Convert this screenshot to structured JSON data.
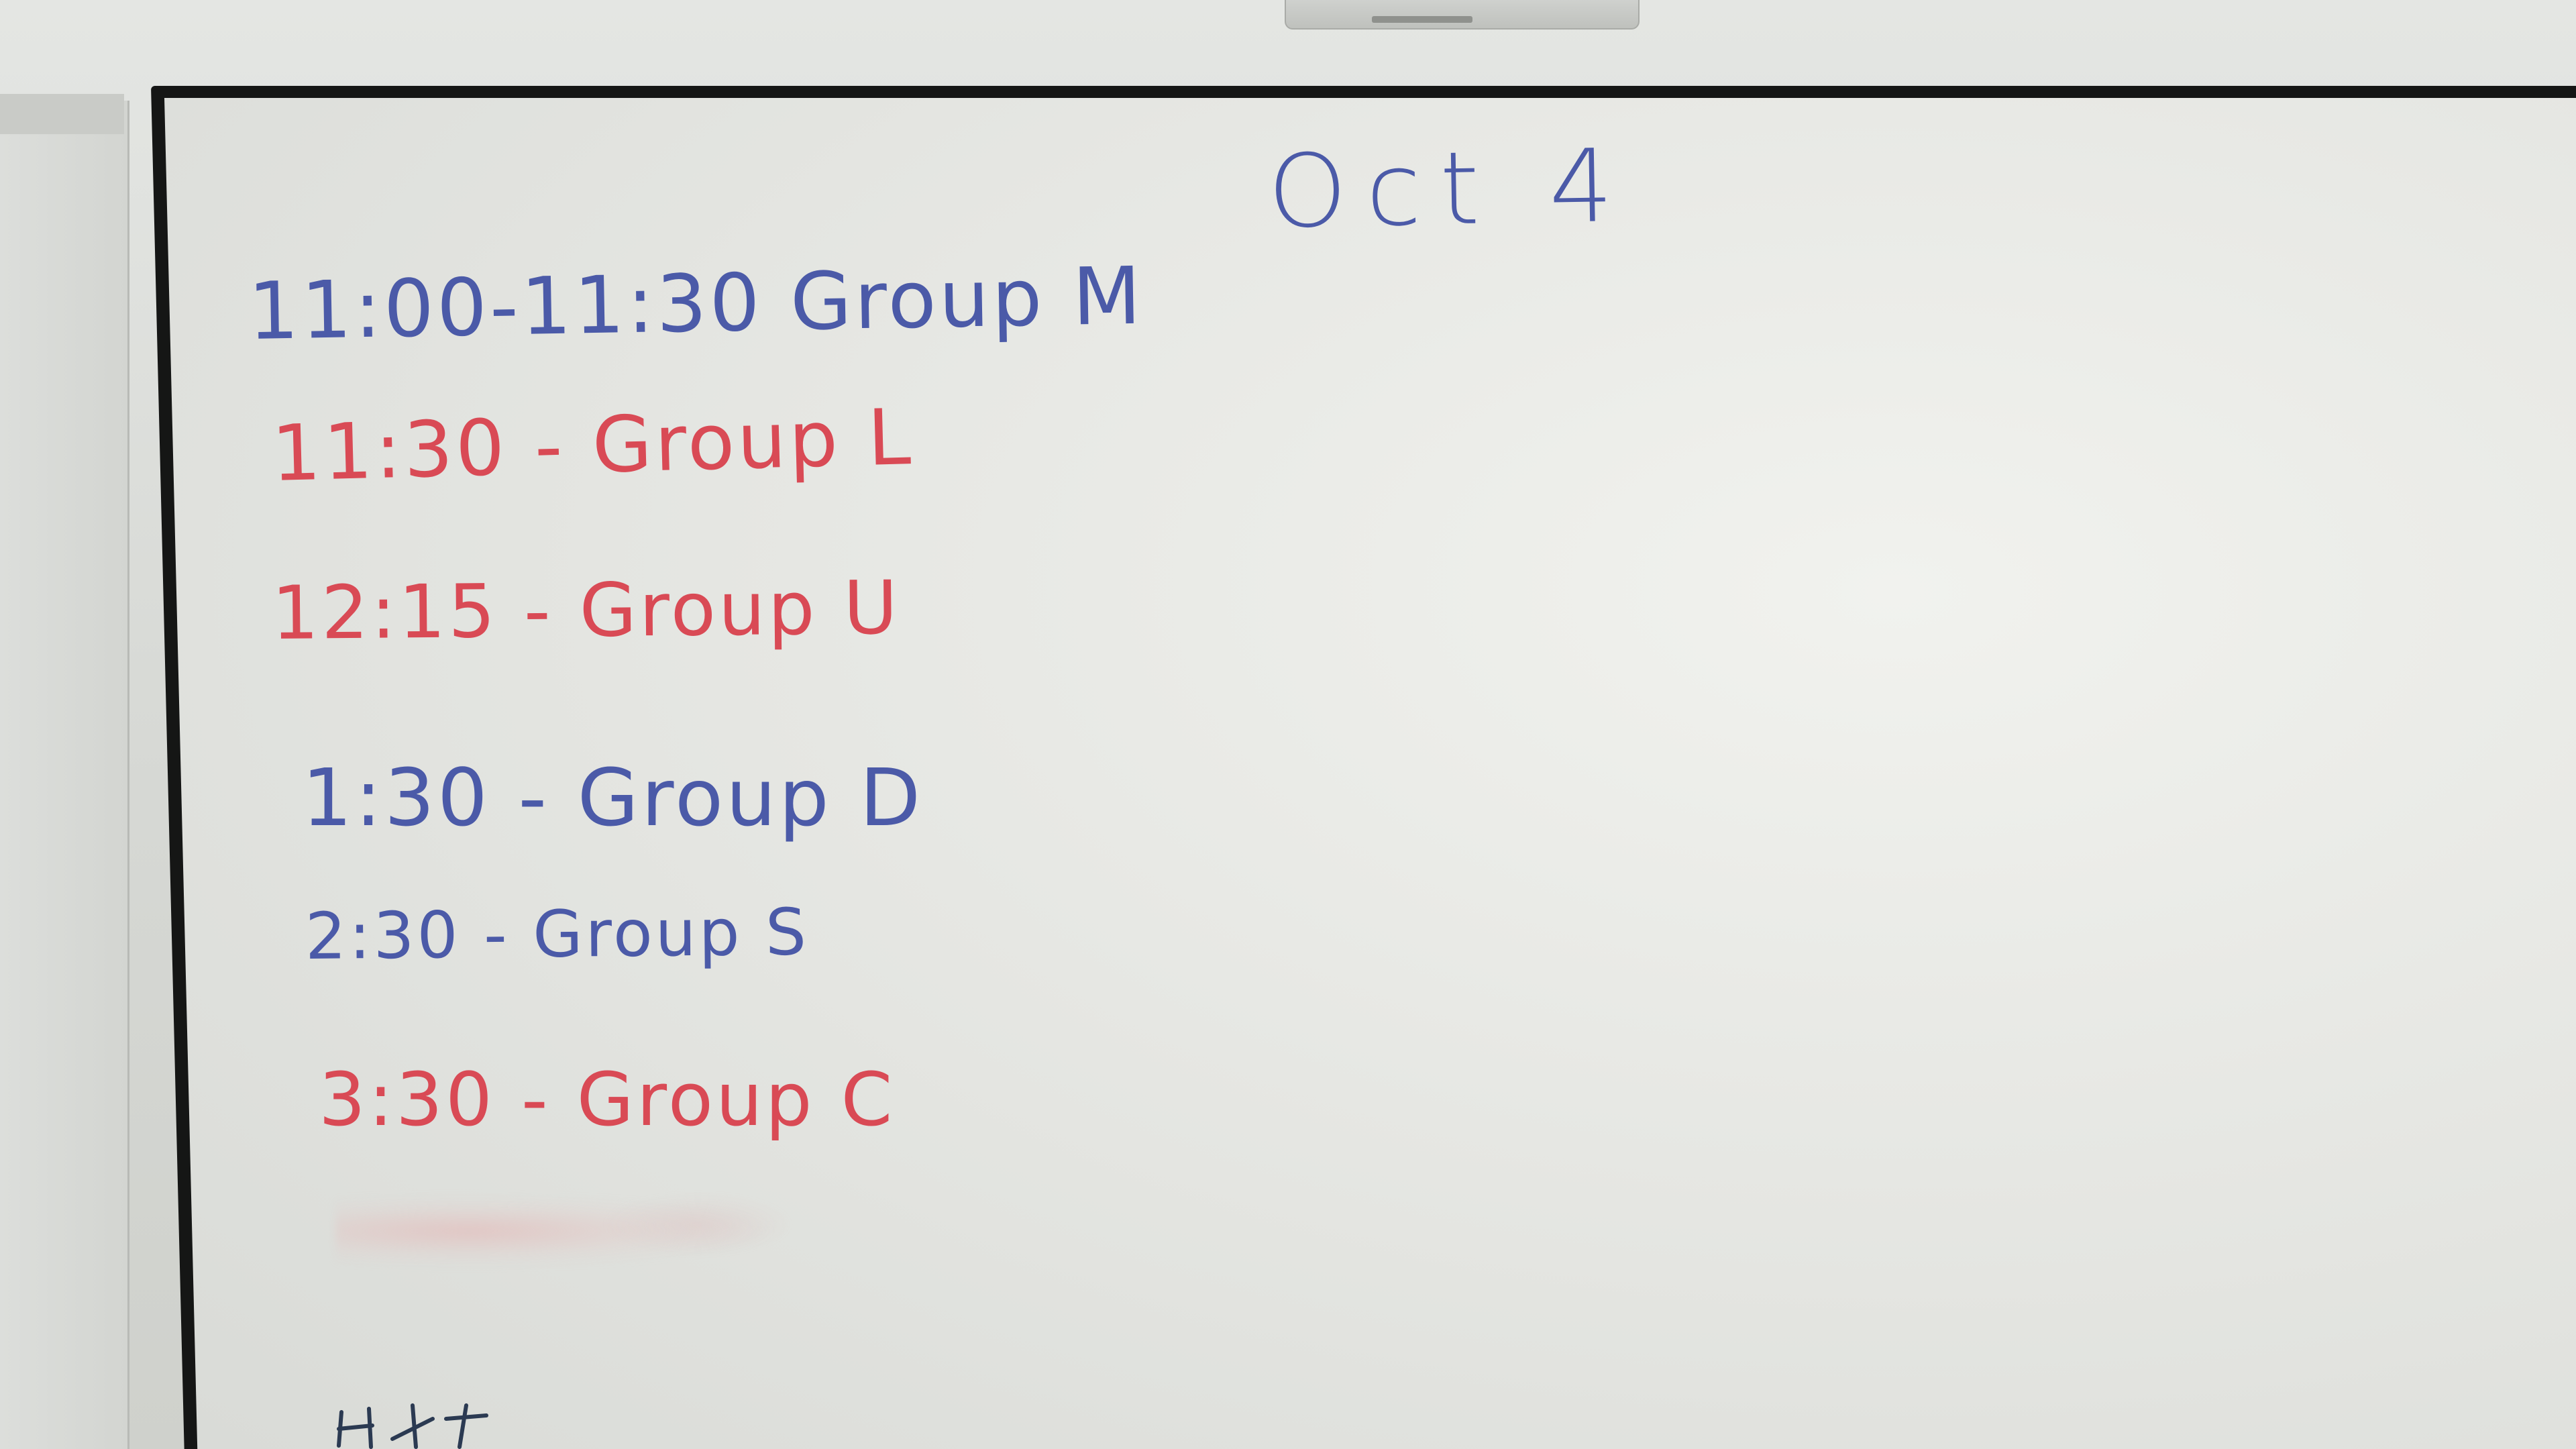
{
  "board": {
    "date": "Oct 4",
    "schedule": [
      {
        "text": "11:00-11:30 Group M",
        "color": "#4b5aa8"
      },
      {
        "text": "11:30 - Group L",
        "color": "#d94a55"
      },
      {
        "text": "12:15 - Group U",
        "color": "#d94a55"
      },
      {
        "text": "1:30 - Group D",
        "color": "#4b5aa8"
      },
      {
        "text": "2:30 - Group S",
        "color": "#4b5aa8"
      },
      {
        "text": "3:30 - Group C",
        "color": "#d94a55"
      }
    ]
  }
}
